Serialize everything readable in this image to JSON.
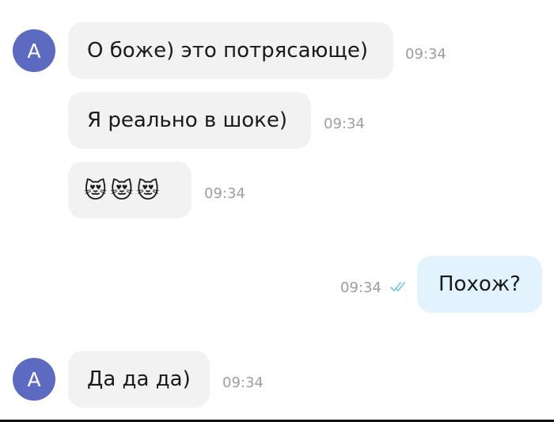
{
  "messages": [
    {
      "author_initial": "A",
      "text": "О боже) это потрясающе)",
      "time": "09:34"
    },
    {
      "text": "Я реально в шоке)",
      "time": "09:34"
    },
    {
      "emoji": [
        "😻",
        "😻",
        "😻"
      ],
      "time": "09:34"
    },
    {
      "text": "Похож?",
      "time": "09:34",
      "status": "read-double-check"
    },
    {
      "author_initial": "A",
      "text": "Да да да)",
      "time": "09:34"
    }
  ],
  "colors": {
    "avatar": "#5c6bc0",
    "incoming_bubble": "#f2f2f2",
    "outgoing_bubble": "#e3f3fd",
    "timestamp": "#9e9e9e",
    "read_check": "#7ec8e3"
  }
}
